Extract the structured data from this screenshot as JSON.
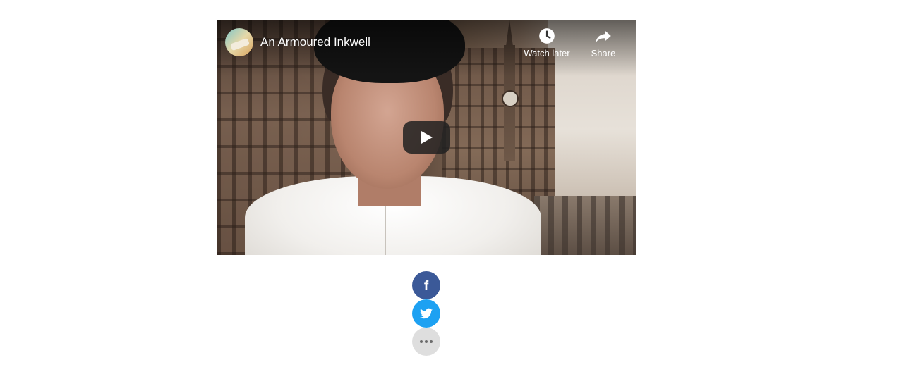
{
  "video": {
    "title": "An Armoured Inkwell",
    "channel_icon": "channel-avatar",
    "actions": {
      "watch_later": {
        "label": "Watch later",
        "icon": "clock-icon"
      },
      "share": {
        "label": "Share",
        "icon": "share-arrow-icon"
      }
    },
    "play_icon": "play-icon"
  },
  "social": {
    "facebook": {
      "glyph": "f",
      "icon": "facebook-icon",
      "color": "#3b5998"
    },
    "twitter": {
      "icon": "twitter-icon",
      "color": "#1da1f2"
    },
    "more": {
      "icon": "more-dots-icon",
      "color": "#dedede"
    }
  }
}
